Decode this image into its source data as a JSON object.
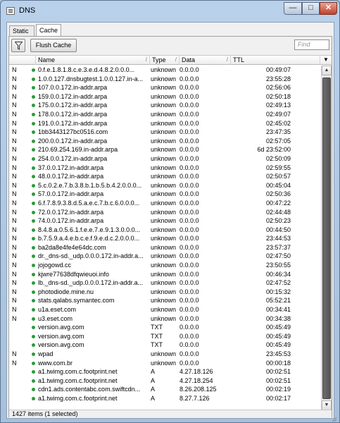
{
  "window": {
    "title": "DNS",
    "controls": {
      "minimize": "—",
      "maximize": "□",
      "close": "✕"
    }
  },
  "tabs": [
    {
      "label": "Static",
      "active": false
    },
    {
      "label": "Cache",
      "active": true
    }
  ],
  "toolbar": {
    "filter_icon": "funnel-icon",
    "flush_label": "Flush Cache",
    "find_placeholder": "Find"
  },
  "table": {
    "columns": [
      "Name",
      "Type",
      "Data",
      "TTL"
    ],
    "rows": [
      {
        "flag": "N",
        "name": "0.f.e.1.8.1.8.c.e.3.e.d.4.8.2.0.0.0...",
        "type": "unknown",
        "data": "0.0.0.0",
        "ttl": "00:49:07"
      },
      {
        "flag": "N",
        "name": "1.0.0.127.dnsbugtest.1.0.0.127.in-a...",
        "type": "unknown",
        "data": "0.0.0.0",
        "ttl": "23:55:28"
      },
      {
        "flag": "N",
        "name": "107.0.0.172.in-addr.arpa",
        "type": "unknown",
        "data": "0.0.0.0",
        "ttl": "02:56:06"
      },
      {
        "flag": "N",
        "name": "159.0.0.172.in-addr.arpa",
        "type": "unknown",
        "data": "0.0.0.0",
        "ttl": "02:50:18"
      },
      {
        "flag": "N",
        "name": "175.0.0.172.in-addr.arpa",
        "type": "unknown",
        "data": "0.0.0.0",
        "ttl": "02:49:13"
      },
      {
        "flag": "N",
        "name": "178.0.0.172.in-addr.arpa",
        "type": "unknown",
        "data": "0.0.0.0",
        "ttl": "02:49:07"
      },
      {
        "flag": "N",
        "name": "191.0.0.172.in-addr.arpa",
        "type": "unknown",
        "data": "0.0.0.0",
        "ttl": "02:45:02"
      },
      {
        "flag": "N",
        "name": "1bb3443127bc0516.com",
        "type": "unknown",
        "data": "0.0.0.0",
        "ttl": "23:47:35"
      },
      {
        "flag": "N",
        "name": "200.0.0.172.in-addr.arpa",
        "type": "unknown",
        "data": "0.0.0.0",
        "ttl": "02:57:05"
      },
      {
        "flag": "N",
        "name": "210.69.254.169.in-addr.arpa",
        "type": "unknown",
        "data": "0.0.0.0",
        "ttl": "6d 23:52:00"
      },
      {
        "flag": "N",
        "name": "254.0.0.172.in-addr.arpa",
        "type": "unknown",
        "data": "0.0.0.0",
        "ttl": "02:50:09"
      },
      {
        "flag": "N",
        "name": "37.0.0.172.in-addr.arpa",
        "type": "unknown",
        "data": "0.0.0.0",
        "ttl": "02:59:55"
      },
      {
        "flag": "N",
        "name": "48.0.0.172.in-addr.arpa",
        "type": "unknown",
        "data": "0.0.0.0",
        "ttl": "02:50:57"
      },
      {
        "flag": "N",
        "name": "5.c.0.2.e.7.b.3.8.b.1.b.5.b.4.2.0.0.0...",
        "type": "unknown",
        "data": "0.0.0.0",
        "ttl": "00:45:04"
      },
      {
        "flag": "N",
        "name": "57.0.0.172.in-addr.arpa",
        "type": "unknown",
        "data": "0.0.0.0",
        "ttl": "02:50:36"
      },
      {
        "flag": "N",
        "name": "6.f.7.8.9.3.8.d.5.a.e.c.7.b.c.6.0.0.0...",
        "type": "unknown",
        "data": "0.0.0.0",
        "ttl": "00:47:22"
      },
      {
        "flag": "N",
        "name": "72.0.0.172.in-addr.arpa",
        "type": "unknown",
        "data": "0.0.0.0",
        "ttl": "02:44:48"
      },
      {
        "flag": "N",
        "name": "74.0.0.172.in-addr.arpa",
        "type": "unknown",
        "data": "0.0.0.0",
        "ttl": "02:50:23"
      },
      {
        "flag": "N",
        "name": "8.4.8.a.0.5.6.1.f.e.e.7.e.9.1.3.0.0.0...",
        "type": "unknown",
        "data": "0.0.0.0",
        "ttl": "00:44:50"
      },
      {
        "flag": "N",
        "name": "b.7.5.9.a.4.e.b.c.e.f.9.e.d.c.2.0.0.0...",
        "type": "unknown",
        "data": "0.0.0.0",
        "ttl": "23:44:53"
      },
      {
        "flag": "N",
        "name": "ba2da8e4fe4e64dc.com",
        "type": "unknown",
        "data": "0.0.0.0",
        "ttl": "23:57:37"
      },
      {
        "flag": "N",
        "name": "dr._dns-sd._udp.0.0.0.172.in-addr.a...",
        "type": "unknown",
        "data": "0.0.0.0",
        "ttl": "02:47:50"
      },
      {
        "flag": "N",
        "name": "jojogowd.cc",
        "type": "unknown",
        "data": "0.0.0.0",
        "ttl": "23:50:55"
      },
      {
        "flag": "N",
        "name": "kjwre77638dfqwieuoi.info",
        "type": "unknown",
        "data": "0.0.0.0",
        "ttl": "00:46:34"
      },
      {
        "flag": "N",
        "name": "lb._dns-sd._udp.0.0.0.172.in-addr.a...",
        "type": "unknown",
        "data": "0.0.0.0",
        "ttl": "02:47:52"
      },
      {
        "flag": "N",
        "name": "photodiode.mine.nu",
        "type": "unknown",
        "data": "0.0.0.0",
        "ttl": "00:15:32"
      },
      {
        "flag": "N",
        "name": "stats.qalabs.symantec.com",
        "type": "unknown",
        "data": "0.0.0.0",
        "ttl": "05:52:21"
      },
      {
        "flag": "N",
        "name": "u1a.eset.com",
        "type": "unknown",
        "data": "0.0.0.0",
        "ttl": "00:34:41"
      },
      {
        "flag": "N",
        "name": "u3.eset.com",
        "type": "unknown",
        "data": "0.0.0.0",
        "ttl": "00:34:38"
      },
      {
        "flag": "",
        "name": "version.avg.com",
        "type": "TXT",
        "data": "0.0.0.0",
        "ttl": "00:45:49"
      },
      {
        "flag": "",
        "name": "version.avg.com",
        "type": "TXT",
        "data": "0.0.0.0",
        "ttl": "00:45:49"
      },
      {
        "flag": "",
        "name": "version.avg.com",
        "type": "TXT",
        "data": "0.0.0.0",
        "ttl": "00:45:49"
      },
      {
        "flag": "N",
        "name": "wpad",
        "type": "unknown",
        "data": "0.0.0.0",
        "ttl": "23:45:53"
      },
      {
        "flag": "N",
        "name": "www.com.br",
        "type": "unknown",
        "data": "0.0.0.0",
        "ttl": "00:00:18"
      },
      {
        "flag": "",
        "name": "a1.twimg.com.c.footprint.net",
        "type": "A",
        "data": "4.27.18.126",
        "ttl": "00:02:51"
      },
      {
        "flag": "",
        "name": "a1.twimg.com.c.footprint.net",
        "type": "A",
        "data": "4.27.18.254",
        "ttl": "00:02:51"
      },
      {
        "flag": "",
        "name": "cdn1.ads.contentabc.com.swiftcdn...",
        "type": "A",
        "data": "8.26.208.125",
        "ttl": "00:02:19"
      },
      {
        "flag": "",
        "name": "a1.twimg.com.c.footprint.net",
        "type": "A",
        "data": "8.27.7.126",
        "ttl": "00:02:17"
      }
    ]
  },
  "status": {
    "text": "1427 items (1 selected)"
  }
}
